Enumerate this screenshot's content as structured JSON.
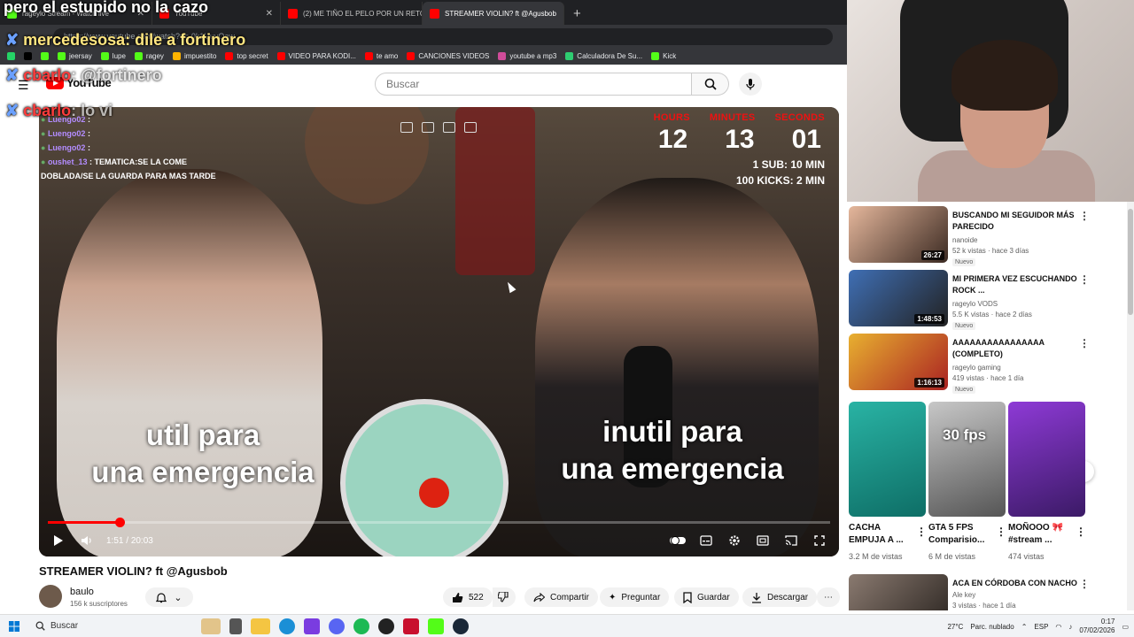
{
  "browser": {
    "tabs": [
      {
        "label": "rageylo Stream - Watch live",
        "color": "#53fc18",
        "active": false
      },
      {
        "label": "YouTube",
        "color": "#ff0000",
        "active": false
      },
      {
        "label": "(2) ME TIÑO EL PELO POR UN RETO",
        "color": "#ff0000",
        "active": false
      },
      {
        "label": "STREAMER VIOLIN? ft @Agusbob",
        "color": "#ff0000",
        "active": true
      }
    ],
    "address": "https://www.youtube.com/watch?v=-0k1UuvQaw",
    "bookmarks": [
      {
        "label": "",
        "color": "#25d366"
      },
      {
        "label": "",
        "color": "#000000"
      },
      {
        "label": "",
        "color": "#53fc18"
      },
      {
        "label": "jeersay",
        "color": "#53fc18"
      },
      {
        "label": "lupe",
        "color": "#53fc18"
      },
      {
        "label": "ragey",
        "color": "#53fc18"
      },
      {
        "label": "impuestito",
        "color": "#ffb300"
      },
      {
        "label": "top secret",
        "color": "#ff0000"
      },
      {
        "label": "VIDEO PARA KODI...",
        "color": "#ff0000"
      },
      {
        "label": "te amo",
        "color": "#ff0000"
      },
      {
        "label": "CANCIONES VIDEOS",
        "color": "#ff0000"
      },
      {
        "label": "youtube a mp3",
        "color": "#d04c9a"
      },
      {
        "label": "Calculadora De Su...",
        "color": "#2ecc71"
      },
      {
        "label": "Kick",
        "color": "#53fc18"
      }
    ]
  },
  "stream_overlay": {
    "top_text": "pero el estupido no la cazo",
    "chat": [
      {
        "user": "mercedesosa",
        "message": ": dile a fortinero",
        "color": "#ffe680"
      },
      {
        "user": "cbarlo",
        "message": ": @fortinero",
        "color": "#ff3c3c"
      },
      {
        "user": "cbarlo",
        "message": ": lo vi",
        "color": "#ff3c3c"
      }
    ]
  },
  "youtube": {
    "logo": "YouTube",
    "search_placeholder": "Buscar"
  },
  "video": {
    "chat_overlay": [
      {
        "user": "Luengo02",
        "message": ":",
        "color": "#b38cff"
      },
      {
        "user": "Luengo02",
        "message": ":",
        "color": "#b38cff"
      },
      {
        "user": "Luengo02",
        "message": ":",
        "color": "#b38cff"
      },
      {
        "user": "oushet_13",
        "message": ": TEMATICA:SE LA COME DOBLADA/SE LA GUARDA PARA MAS TARDE",
        "color": "#b38cff"
      }
    ],
    "timer": {
      "labels": [
        "HOURS",
        "MINUTES",
        "SECONDS"
      ],
      "values": [
        "12",
        "13",
        "01"
      ],
      "rule_1": "1 SUB: 10 MIN",
      "rule_2": "100 KICKS: 2 MIN"
    },
    "subtitle_left": [
      "util  para",
      "una emergencia"
    ],
    "subtitle_right": [
      "inutil para",
      "una emergencia"
    ],
    "progress": 0.092,
    "time_current": "1:51",
    "time_total": "20:03",
    "title": "STREAMER VIOLIN? ft @Agusbob",
    "channel": "baulo",
    "subscribers": "156 k suscriptores",
    "likes": "522",
    "actions": {
      "share": "Compartir",
      "ask": "Preguntar",
      "save": "Guardar",
      "download": "Descargar"
    }
  },
  "recommended": [
    {
      "title": "BUSCANDO MI SEGUIDOR MÁS PARECIDO",
      "channel": "nanoide",
      "meta": "52 k vistas · hace 3 días",
      "duration": "26:27",
      "badge": "Nuevo",
      "colors": [
        "#e5b79c",
        "#3b2a22"
      ]
    },
    {
      "title": "MI PRIMERA VEZ ESCUCHANDO ROCK ...",
      "channel": "rageylo VODS",
      "meta": "5.5 K vistas · hace 2 días",
      "duration": "1:48:53",
      "badge": "Nuevo",
      "colors": [
        "#3f6fb5",
        "#222222"
      ]
    },
    {
      "title": "AAAAAAAAAAAAAAAA (COMPLETO)",
      "channel": "rageylo gaming",
      "meta": "419 vistas · hace 1 día",
      "duration": "1:16:13",
      "badge": "Nuevo",
      "colors": [
        "#e8b030",
        "#aa2222"
      ]
    }
  ],
  "shorts": [
    {
      "title": "CACHA EMPUJA A ...",
      "views": "3.2 M de vistas",
      "colors": [
        "#29b3a4",
        "#0e6e66"
      ]
    },
    {
      "title": "GTA 5 FPS Comparisio...",
      "views": "6 M de vistas",
      "colors": [
        "#c7c7c7",
        "#555555"
      ],
      "overlay": "30 fps"
    },
    {
      "title": "MOÑOOO 🎀 #stream ...",
      "views": "474 vistas",
      "colors": [
        "#8e3ad6",
        "#3b1a66"
      ]
    }
  ],
  "recommended_last": {
    "title": "ACA EN CÓRDOBA CON NACHO",
    "channel": "Ale key",
    "meta": "3 vistas · hace 1 día"
  },
  "taskbar": {
    "search": "Buscar",
    "weather_temp": "27°C",
    "weather_text": "Parc. nublado",
    "lang": "ESP",
    "time": "0:17",
    "date": "07/02/2026"
  }
}
